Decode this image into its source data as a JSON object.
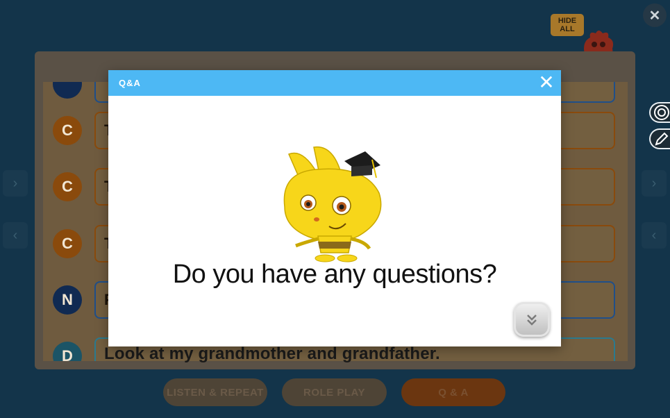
{
  "topbar": {
    "hide_all_label": "HIDE ALL",
    "close_symbol": "✕"
  },
  "conversation": {
    "rows": [
      {
        "badge": "C",
        "text": "T"
      },
      {
        "badge": "C",
        "text": "T"
      },
      {
        "badge": "C",
        "text": "T"
      },
      {
        "badge": "N",
        "text": "F"
      },
      {
        "badge": "D",
        "text": "Look at my grandmother and grandfather."
      }
    ]
  },
  "bottom_nav": {
    "listen_repeat": "LISTEN & REPEAT",
    "role_play": "ROLE PLAY",
    "qa": "Q & A",
    "active_tab": "Q & A"
  },
  "modal": {
    "title": "Q&A",
    "close_symbol": "✕",
    "question": "Do you have any questions?"
  },
  "colors": {
    "modal_header": "#4db8f4",
    "badge_c": "#8a4a0c",
    "badge_n": "#102a52",
    "badge_d": "#1b5466"
  }
}
